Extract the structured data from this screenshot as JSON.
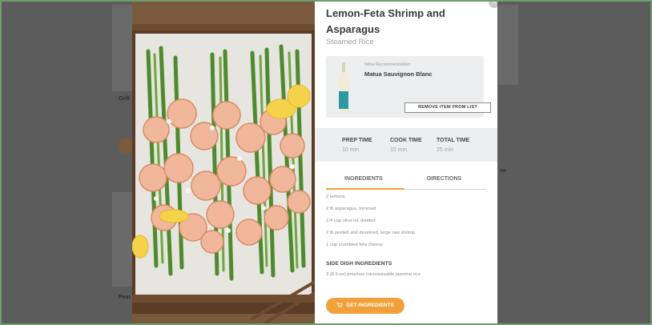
{
  "background_page": {
    "card_titles": [
      "Grill",
      "Pear"
    ],
    "right_card_fragment": "ce"
  },
  "modal": {
    "close_symbol": "×",
    "recipe": {
      "title": "Lemon-Feta Shrimp and Asparagus",
      "subtitle": "Steamed Rice"
    },
    "wine": {
      "label": "Wine Recommendation",
      "name": "Matua Sauvignon Blanc",
      "remove_button": "REMOVE ITEM FROM LIST"
    },
    "times": {
      "prep": {
        "label": "PREP TIME",
        "value": "10 min"
      },
      "cook": {
        "label": "COOK TIME",
        "value": "15 min"
      },
      "total": {
        "label": "TOTAL TIME",
        "value": "25 min"
      }
    },
    "tabs": {
      "ingredients": "INGREDIENTS",
      "directions": "DIRECTIONS",
      "active": "ingredients"
    },
    "ingredients": [
      "2 lemons",
      "2 lb asparagus, trimmed",
      "1/4 cup olive oil, divided",
      "2 lb peeled and deveined, large raw shrimp",
      "1 cup crumbled feta cheese"
    ],
    "side_dish": {
      "heading": "SIDE DISH INGREDIENTS",
      "items": [
        "3 (8.5-oz) pouches microwavable jasmine rice"
      ]
    },
    "get_ingredients_button": "GET INGREDIENTS",
    "icons": [
      "close-icon",
      "wine-bottle-icon",
      "cart-icon"
    ],
    "colors": {
      "accent": "#f2a13a",
      "panel": "#eceeef"
    }
  }
}
